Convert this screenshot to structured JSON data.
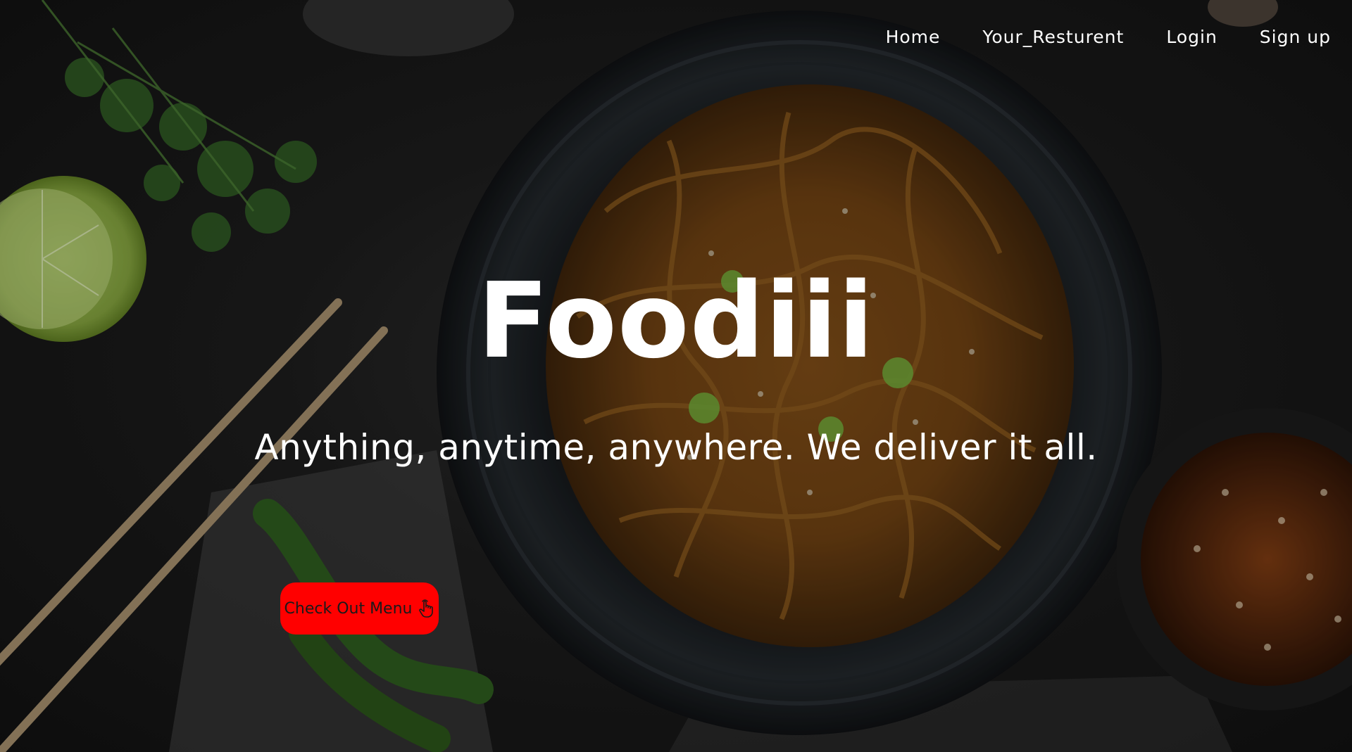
{
  "nav": {
    "items": [
      {
        "label": "Home"
      },
      {
        "label": "Your_Resturent"
      },
      {
        "label": "Login"
      },
      {
        "label": "Sign up"
      }
    ]
  },
  "hero": {
    "brand": "Foodiii",
    "tagline": "Anything, anytime, anywhere. We deliver it all.",
    "cta_label": "Check Out Menu",
    "cta_icon": "pointer-hand-icon"
  },
  "colors": {
    "cta_background": "#ff0000",
    "text": "#ffffff",
    "background": "#141414"
  }
}
